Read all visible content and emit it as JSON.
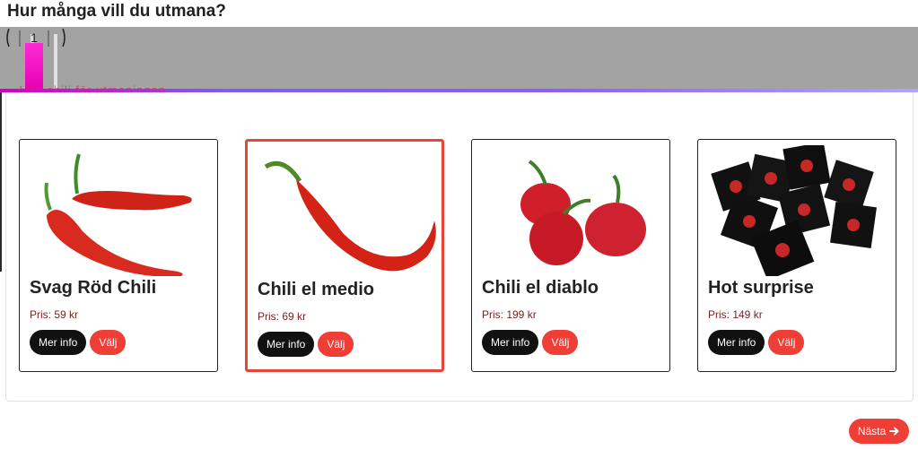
{
  "question": "Hur många vill du utmana?",
  "stepper": {
    "value": "1"
  },
  "overlay_text": "Välj chili för utmaningen",
  "products": [
    {
      "name": "Svag Röd Chili",
      "price": "Pris: 59 kr",
      "info_label": "Mer info",
      "pick_label": "Välj",
      "selected": false,
      "image_icon": "red-chili-peppers-image"
    },
    {
      "name": "Chili el medio",
      "price": "Pris: 69 kr",
      "info_label": "Mer info",
      "pick_label": "Välj",
      "selected": true,
      "image_icon": "long-chili-pepper-image"
    },
    {
      "name": "Chili el diablo",
      "price": "Pris: 199 kr",
      "info_label": "Mer info",
      "pick_label": "Välj",
      "selected": false,
      "image_icon": "habanero-peppers-image"
    },
    {
      "name": "Hot surprise",
      "price": "Pris: 149 kr",
      "info_label": "Mer info",
      "pick_label": "Välj",
      "selected": false,
      "image_icon": "black-packets-image"
    }
  ],
  "next_button": {
    "label": "Nästa"
  },
  "colors": {
    "accent": "#ef3e36",
    "selected_border": "#ea4436",
    "dark_button": "#111111"
  }
}
